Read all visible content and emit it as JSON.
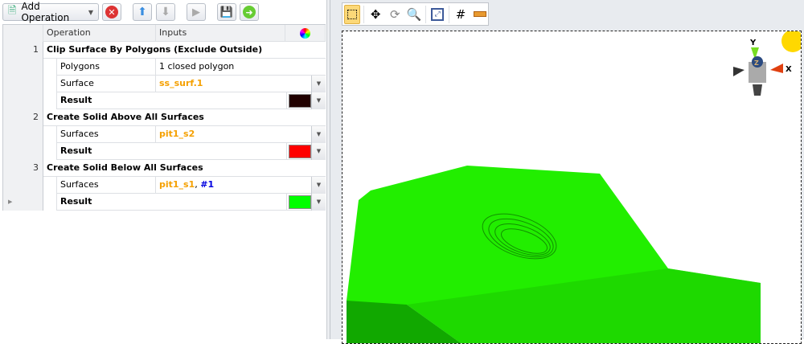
{
  "toolbar": {
    "add_operation": "Add Operation"
  },
  "grid": {
    "headers": {
      "operation": "Operation",
      "inputs": "Inputs"
    },
    "operations": [
      {
        "num": "1",
        "name": "Clip Surface By Polygons (Exclude Outside)",
        "rows": [
          {
            "label": "Polygons",
            "value": "1 closed polygon"
          },
          {
            "label": "Surface",
            "value": "ss_surf.1"
          }
        ],
        "result": "Result",
        "result_color": "#200000"
      },
      {
        "num": "2",
        "name": "Create Solid Above All Surfaces",
        "rows": [
          {
            "label": "Surfaces",
            "value": "pit1_s2"
          }
        ],
        "result": "Result",
        "result_color": "#ff0000"
      },
      {
        "num": "3",
        "name": "Create Solid Below All Surfaces",
        "rows": [
          {
            "label": "Surfaces",
            "value": "pit1_s1",
            "value_sep": ", ",
            "value_extra": "#1"
          }
        ],
        "result": "Result",
        "result_color": "#00ff00"
      }
    ]
  },
  "viewer": {
    "axes": {
      "x": "X",
      "y": "Y",
      "z": "Z"
    },
    "solid_color": "#22ee00"
  }
}
